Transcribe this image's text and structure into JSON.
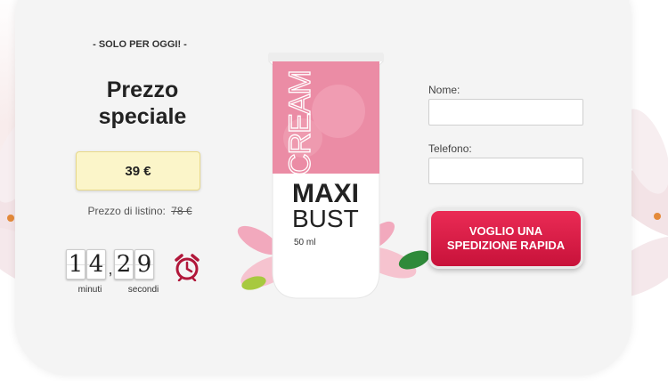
{
  "offer": {
    "badge": "- SOLO PER OGGI! -",
    "title": "Prezzo speciale",
    "price": "39 €",
    "list_price_label": "Prezzo di listino:",
    "list_price": "78 €"
  },
  "timer": {
    "minutes": [
      "1",
      "4"
    ],
    "seconds": [
      "2",
      "9"
    ],
    "separator": ",",
    "minutes_label": "minuti",
    "seconds_label": "secondi"
  },
  "product": {
    "word1": "CREAM",
    "word2": "MAXI",
    "word3": "BUST",
    "volume": "50 ml"
  },
  "form": {
    "name_label": "Nome:",
    "name_value": "",
    "phone_label": "Telefono:",
    "phone_value": "",
    "submit_label": "VOGLIO UNA SPEDIZIONE RAPIDA"
  },
  "colors": {
    "accent": "#d91c45",
    "price_box": "#fbf5c9",
    "tube_pink": "#eb8ca5"
  }
}
